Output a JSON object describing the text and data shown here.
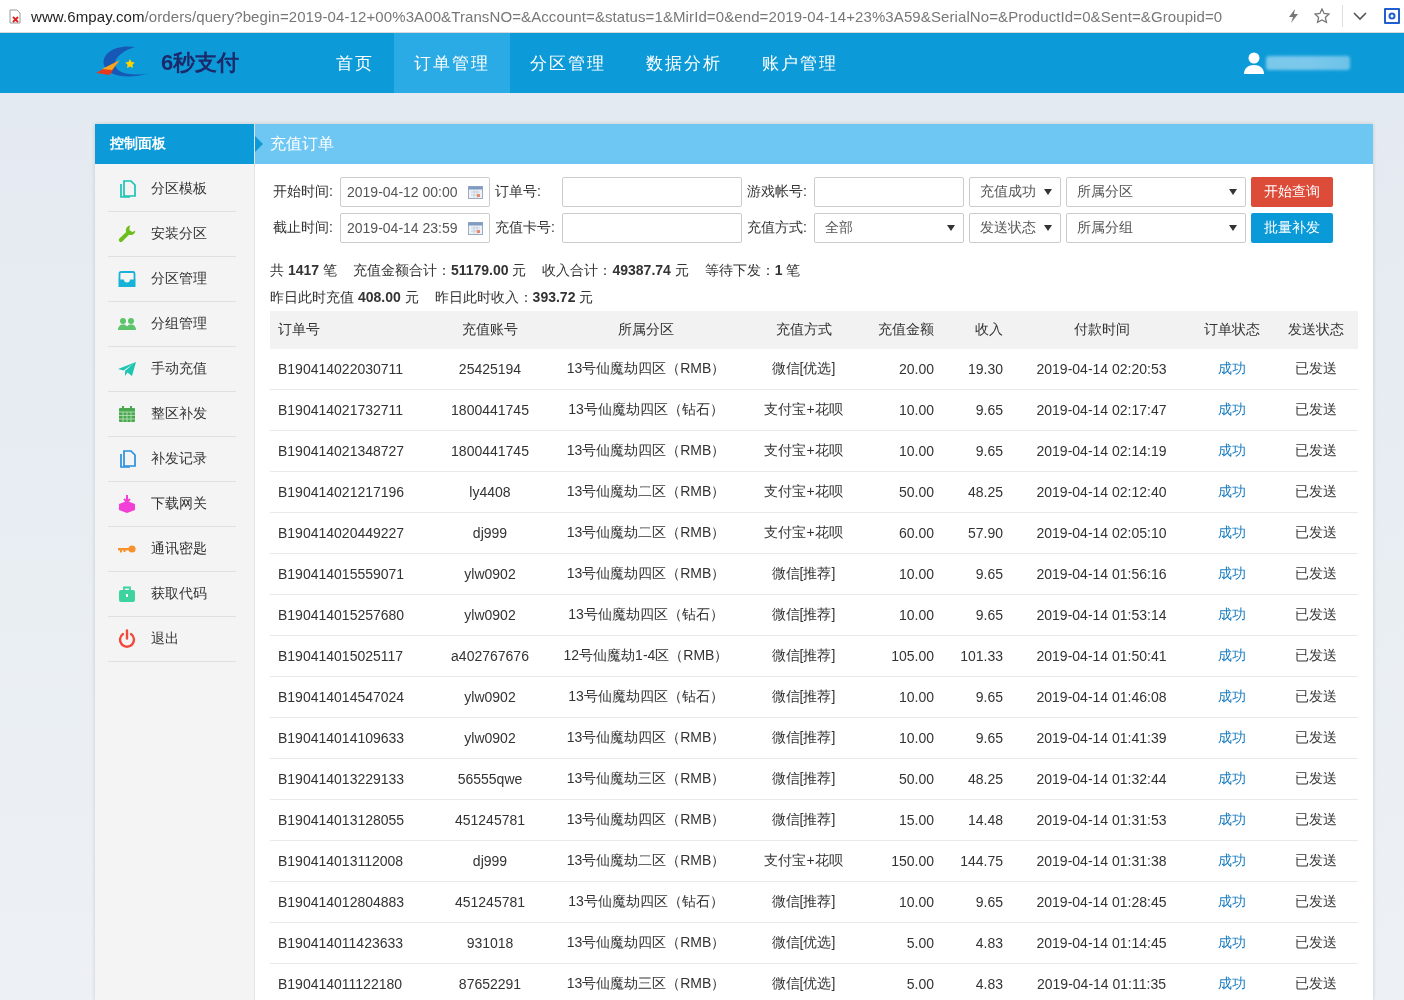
{
  "address_bar": {
    "host": "www.6mpay.com",
    "path": "/orders/query?begin=2019-04-12+00%3A00&TransNO=&Account=&status=1&MirId=0&end=2019-04-14+23%3A59&SerialNo=&ProductId=0&Sent=&Groupid=0"
  },
  "header": {
    "logo_text": "6秒支付",
    "tabs": [
      {
        "label": "首页",
        "selected": false
      },
      {
        "label": "订单管理",
        "selected": true
      },
      {
        "label": "分区管理",
        "selected": false
      },
      {
        "label": "数据分析",
        "selected": false
      },
      {
        "label": "账户管理",
        "selected": false
      }
    ]
  },
  "sidebar": {
    "title": "控制面板",
    "items": [
      "分区模板",
      "安装分区",
      "分区管理",
      "分组管理",
      "手动充值",
      "整区补发",
      "补发记录",
      "下载网关",
      "通讯密匙",
      "获取代码",
      "退出"
    ]
  },
  "content": {
    "title": "充值订单",
    "filters": [
      [
        {
          "kind": "date",
          "label": "开始时间:",
          "value": "2019-04-12 00:00"
        },
        {
          "kind": "text",
          "label": "订单号:"
        },
        {
          "kind": "text",
          "label": "游戏帐号:"
        },
        {
          "kind": "select",
          "value": "充值成功"
        },
        {
          "kind": "select",
          "value": "所属分区"
        },
        {
          "kind": "button",
          "label": "开始查询",
          "color": "#dd4b39"
        }
      ],
      [
        {
          "kind": "date",
          "label": "截止时间:",
          "value": "2019-04-14 23:59"
        },
        {
          "kind": "text",
          "label": "充值卡号:"
        },
        {
          "kind": "select",
          "label": "充值方式:",
          "value": "全部"
        },
        {
          "kind": "select",
          "value": "发送状态"
        },
        {
          "kind": "select",
          "value": "所属分组"
        },
        {
          "kind": "button",
          "label": "批量补发",
          "color": "#0b9ad8"
        }
      ]
    ],
    "summary_lines": [
      [
        "共 **1417** 笔",
        "充值金额合计：**51179.00** 元",
        "收入合计：**49387.74** 元",
        "等待下发：**1** 笔"
      ],
      [
        "昨日此时充值 **408.00** 元",
        "昨日此时收入：**393.72** 元"
      ]
    ],
    "table": {
      "columns": [
        "订单号",
        "充值账号",
        "所属分区",
        "充值方式",
        "充值金额",
        "收入",
        "付款时间",
        "订单状态",
        "发送状态"
      ],
      "rows": [
        {
          "order_no": "B190414022030711",
          "account": "25425194",
          "zone": "13号仙魔劫四区（RMB）",
          "payment_method": "微信[优选]",
          "amount": "20.00",
          "income": "19.30",
          "paid_at": "2019-04-14 02:20:53",
          "order_status": "成功",
          "send_status": "已发送"
        },
        {
          "order_no": "B190414021732711",
          "account": "1800441745",
          "zone": "13号仙魔劫四区（钻石）",
          "payment_method": "支付宝+花呗",
          "amount": "10.00",
          "income": "9.65",
          "paid_at": "2019-04-14 02:17:47",
          "order_status": "成功",
          "send_status": "已发送"
        },
        {
          "order_no": "B190414021348727",
          "account": "1800441745",
          "zone": "13号仙魔劫四区（RMB）",
          "payment_method": "支付宝+花呗",
          "amount": "10.00",
          "income": "9.65",
          "paid_at": "2019-04-14 02:14:19",
          "order_status": "成功",
          "send_status": "已发送"
        },
        {
          "order_no": "B190414021217196",
          "account": "ly4408",
          "zone": "13号仙魔劫二区（RMB）",
          "payment_method": "支付宝+花呗",
          "amount": "50.00",
          "income": "48.25",
          "paid_at": "2019-04-14 02:12:40",
          "order_status": "成功",
          "send_status": "已发送"
        },
        {
          "order_no": "B190414020449227",
          "account": "dj999",
          "zone": "13号仙魔劫二区（RMB）",
          "payment_method": "支付宝+花呗",
          "amount": "60.00",
          "income": "57.90",
          "paid_at": "2019-04-14 02:05:10",
          "order_status": "成功",
          "send_status": "已发送"
        },
        {
          "order_no": "B190414015559071",
          "account": "ylw0902",
          "zone": "13号仙魔劫四区（RMB）",
          "payment_method": "微信[推荐]",
          "amount": "10.00",
          "income": "9.65",
          "paid_at": "2019-04-14 01:56:16",
          "order_status": "成功",
          "send_status": "已发送"
        },
        {
          "order_no": "B190414015257680",
          "account": "ylw0902",
          "zone": "13号仙魔劫四区（钻石）",
          "payment_method": "微信[推荐]",
          "amount": "10.00",
          "income": "9.65",
          "paid_at": "2019-04-14 01:53:14",
          "order_status": "成功",
          "send_status": "已发送"
        },
        {
          "order_no": "B190414015025117",
          "account": "a402767676",
          "zone": "12号仙魔劫1-4区（RMB）",
          "payment_method": "微信[推荐]",
          "amount": "105.00",
          "income": "101.33",
          "paid_at": "2019-04-14 01:50:41",
          "order_status": "成功",
          "send_status": "已发送"
        },
        {
          "order_no": "B190414014547024",
          "account": "ylw0902",
          "zone": "13号仙魔劫四区（钻石）",
          "payment_method": "微信[推荐]",
          "amount": "10.00",
          "income": "9.65",
          "paid_at": "2019-04-14 01:46:08",
          "order_status": "成功",
          "send_status": "已发送"
        },
        {
          "order_no": "B190414014109633",
          "account": "ylw0902",
          "zone": "13号仙魔劫四区（RMB）",
          "payment_method": "微信[推荐]",
          "amount": "10.00",
          "income": "9.65",
          "paid_at": "2019-04-14 01:41:39",
          "order_status": "成功",
          "send_status": "已发送"
        },
        {
          "order_no": "B190414013229133",
          "account": "56555qwe",
          "zone": "13号仙魔劫三区（RMB）",
          "payment_method": "微信[推荐]",
          "amount": "50.00",
          "income": "48.25",
          "paid_at": "2019-04-14 01:32:44",
          "order_status": "成功",
          "send_status": "已发送"
        },
        {
          "order_no": "B190414013128055",
          "account": "451245781",
          "zone": "13号仙魔劫四区（RMB）",
          "payment_method": "微信[推荐]",
          "amount": "15.00",
          "income": "14.48",
          "paid_at": "2019-04-14 01:31:53",
          "order_status": "成功",
          "send_status": "已发送"
        },
        {
          "order_no": "B190414013112008",
          "account": "dj999",
          "zone": "13号仙魔劫二区（RMB）",
          "payment_method": "支付宝+花呗",
          "amount": "150.00",
          "income": "144.75",
          "paid_at": "2019-04-14 01:31:38",
          "order_status": "成功",
          "send_status": "已发送"
        },
        {
          "order_no": "B190414012804883",
          "account": "451245781",
          "zone": "13号仙魔劫四区（钻石）",
          "payment_method": "微信[推荐]",
          "amount": "10.00",
          "income": "9.65",
          "paid_at": "2019-04-14 01:28:45",
          "order_status": "成功",
          "send_status": "已发送"
        },
        {
          "order_no": "B190414011423633",
          "account": "931018",
          "zone": "13号仙魔劫四区（RMB）",
          "payment_method": "微信[优选]",
          "amount": "5.00",
          "income": "4.83",
          "paid_at": "2019-04-14 01:14:45",
          "order_status": "成功",
          "send_status": "已发送"
        },
        {
          "order_no": "B190414011122180",
          "account": "87652291",
          "zone": "13号仙魔劫三区（RMB）",
          "payment_method": "微信[优选]",
          "amount": "5.00",
          "income": "4.83",
          "paid_at": "2019-04-14 01:11:35",
          "order_status": "成功",
          "send_status": "已发送"
        }
      ]
    }
  }
}
